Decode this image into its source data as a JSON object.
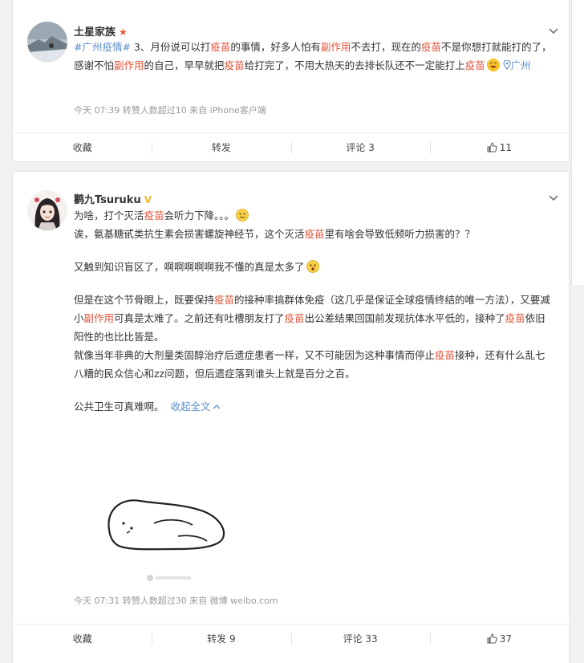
{
  "post1": {
    "author": "土星家族",
    "badge_color": "#e8552f",
    "tag": "#广州疫情#",
    "text_segments": [
      {
        "t": " 3、月份说可以打",
        "h": false
      },
      {
        "t": "疫苗",
        "h": true
      },
      {
        "t": "的事情，好多人怕有",
        "h": false
      },
      {
        "t": "副作用",
        "h": true
      },
      {
        "t": "不去打，现在的",
        "h": false
      },
      {
        "t": "疫苗",
        "h": true
      },
      {
        "t": "不是你想打就能打的了，感谢不怕",
        "h": false
      },
      {
        "t": "副作用",
        "h": true
      },
      {
        "t": "的自己，早早就把",
        "h": false
      },
      {
        "t": "疫苗",
        "h": true
      },
      {
        "t": "给打完了，不用大热天的去排长队还不一定能打上",
        "h": false
      },
      {
        "t": "疫苗",
        "h": true
      }
    ],
    "location": "广州",
    "meta": "今天 07:39  转赞人数超过10  来自 iPhone客户端",
    "actions": {
      "collect": "收藏",
      "repost": "转发",
      "comment": "评论 3",
      "like": "11"
    }
  },
  "post2": {
    "author": "鹳九Tsuruku",
    "verified_color": "#f5b72a",
    "p1_a": "为啥，打个灭活",
    "p1_hl": "疫苗",
    "p1_b": "会听力下降。。。",
    "p2_a": "诶，氨基糖甙类抗生素会损害螺旋神经节，这个灭活",
    "p2_hl": "疫苗",
    "p2_b": "里有啥会导致低频听力损害的？？",
    "p3": "又触到知识盲区了，啊啊啊啊啊我不懂的真是太多了",
    "p4_a": "但是在这个节骨眼上，既要保持",
    "p4_hl1": "疫苗",
    "p4_b": "的接种率搞群体免疫（这几乎是保证全球疫情终结的唯一方法），又要减小",
    "p4_hl2": "副作用",
    "p4_c": "可真是太难了。之前还有吐槽朋友打了",
    "p4_hl3": "疫苗",
    "p4_d": "出公差结果回国前发现抗体水平低的，接种了",
    "p4_hl4": "疫苗",
    "p4_e": "依旧阳性的也比比皆是。",
    "p5_a": "就像当年非典的大剂量类固醇治疗后遗症患者一样，又不可能因为这种事情而停止",
    "p5_hl": "疫苗",
    "p5_b": "接种，还有什么乱七八糟的民众信心和zz问题，但后遗症落到谁头上就是百分之百。",
    "p6": "公共卫生可真难啊。",
    "collapse": "收起全文",
    "meta": "今天 07:31  转赞人数超过30  来自 微博 weibo.com",
    "actions": {
      "collect": "收藏",
      "repost": "转发 9",
      "comment": "评论 33",
      "like": "37"
    }
  }
}
